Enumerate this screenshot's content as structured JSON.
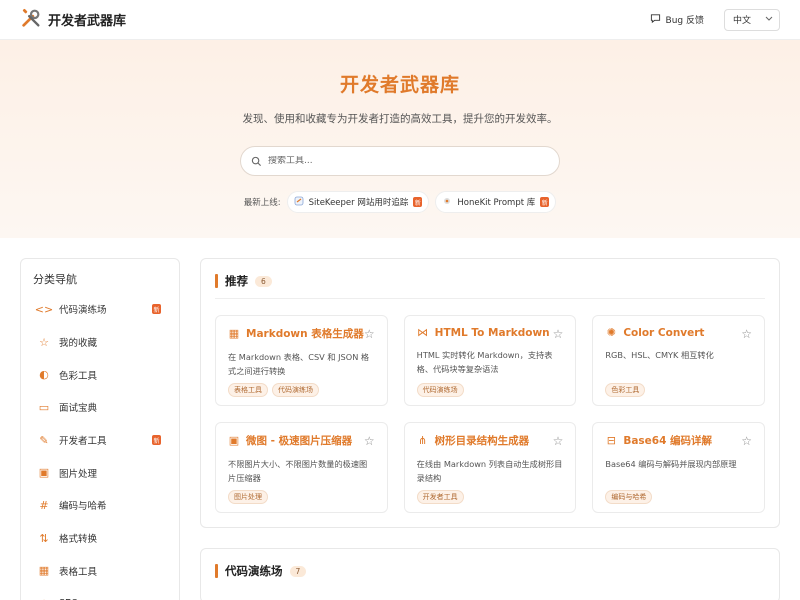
{
  "header": {
    "brand": "开发者武器库",
    "bug_label": "Bug 反馈",
    "lang": "中文"
  },
  "hero": {
    "title": "开发者武器库",
    "subtitle": "发现、使用和收藏专为开发者打造的高效工具，提升您的开发效率。",
    "search_placeholder": "搜索工具...",
    "new_label": "最新上线:",
    "new_badge": "新",
    "new_items": [
      {
        "label": "SiteKeeper 网站用时追踪",
        "icon": "sitekeeper-icon"
      },
      {
        "label": "HoneKit Prompt 库",
        "icon": "honekit-icon"
      }
    ]
  },
  "sidebar": {
    "title": "分类导航",
    "new_badge": "新",
    "items": [
      {
        "label": "代码演练场",
        "icon": "code-icon",
        "glyph": "<>",
        "new": true
      },
      {
        "label": "我的收藏",
        "icon": "star-icon",
        "glyph": "☆",
        "new": false
      },
      {
        "label": "色彩工具",
        "icon": "palette-icon",
        "glyph": "◐",
        "new": false
      },
      {
        "label": "面试宝典",
        "icon": "book-icon",
        "glyph": "▭",
        "new": false
      },
      {
        "label": "开发者工具",
        "icon": "wrench-icon",
        "glyph": "✎",
        "new": true
      },
      {
        "label": "图片处理",
        "icon": "image-icon",
        "glyph": "▣",
        "new": false
      },
      {
        "label": "编码与哈希",
        "icon": "hash-icon",
        "glyph": "#",
        "new": false
      },
      {
        "label": "格式转换",
        "icon": "file-convert-icon",
        "glyph": "⇅",
        "new": false
      },
      {
        "label": "表格工具",
        "icon": "table-icon",
        "glyph": "▦",
        "new": false
      },
      {
        "label": "SEO",
        "icon": "globe-icon",
        "glyph": "◎",
        "new": false
      }
    ]
  },
  "sections": [
    {
      "title": "推荐",
      "count": "6",
      "cards": [
        {
          "title": "Markdown 表格生成器",
          "icon": "table-icon",
          "glyph": "▦",
          "desc": "在 Markdown 表格、CSV 和 JSON 格式之间进行转换",
          "tags": [
            "表格工具",
            "代码演练场"
          ]
        },
        {
          "title": "HTML To Markdown",
          "icon": "code-convert-icon",
          "glyph": "⋈",
          "desc": "HTML 实时转化 Markdown，支持表格、代码块等复杂语法",
          "tags": [
            "代码演练场"
          ]
        },
        {
          "title": "Color Convert",
          "icon": "color-wheel-icon",
          "glyph": "✺",
          "desc": "RGB、HSL、CMYK 相互转化",
          "tags": [
            "色彩工具"
          ]
        },
        {
          "title": "微图 - 极速图片压缩器",
          "icon": "image-icon",
          "glyph": "▣",
          "desc": "不限图片大小、不限图片数量的极速图片压缩器",
          "tags": [
            "图片处理"
          ]
        },
        {
          "title": "树形目录结构生成器",
          "icon": "tree-icon",
          "glyph": "⋔",
          "desc": "在线由 Markdown 列表自动生成树形目录结构",
          "tags": [
            "开发者工具"
          ]
        },
        {
          "title": "Base64 编码详解",
          "icon": "encode-icon",
          "glyph": "⊟",
          "desc": "Base64 编码与解码并展现内部原理",
          "tags": [
            "编码与哈希"
          ]
        }
      ]
    },
    {
      "title": "代码演练场",
      "count": "7",
      "cards": []
    }
  ],
  "colors": {
    "accent": "#e07a2b",
    "badge": "#e8632c",
    "hero_bg": "#fdf0e6"
  }
}
